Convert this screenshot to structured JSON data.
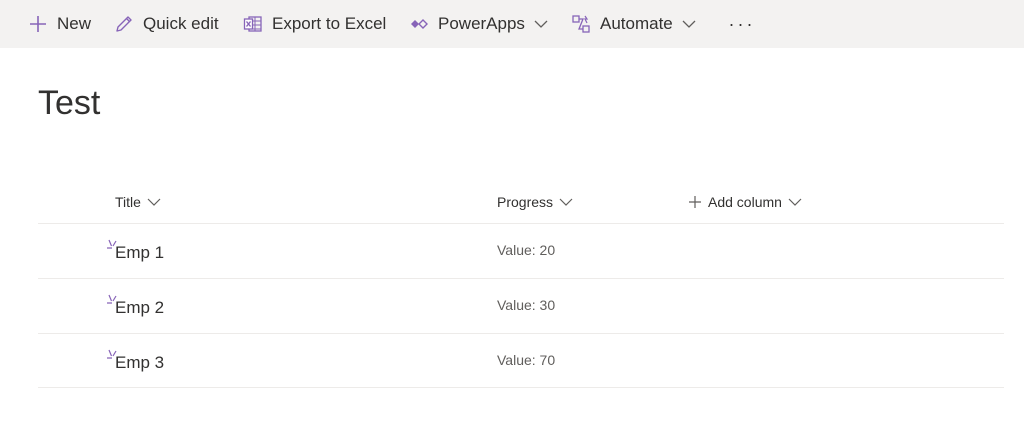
{
  "command_bar": {
    "new_label": "New",
    "quick_edit_label": "Quick edit",
    "export_label": "Export to Excel",
    "powerapps_label": "PowerApps",
    "automate_label": "Automate",
    "more_label": "···"
  },
  "list": {
    "title": "Test",
    "columns": {
      "title": "Title",
      "progress": "Progress",
      "add_column": "Add column"
    },
    "rows": [
      {
        "title": "Emp 1",
        "progress": "Value: 20"
      },
      {
        "title": "Emp 2",
        "progress": "Value: 30"
      },
      {
        "title": "Emp 3",
        "progress": "Value: 70"
      }
    ]
  },
  "colors": {
    "accent": "#8764b8",
    "command_bar_bg": "#f3f2f1",
    "text": "#323130",
    "secondary_text": "#605e5c",
    "divider": "#edebe9"
  },
  "icons": {
    "new": "plus-icon",
    "quick_edit": "pencil-icon",
    "export": "excel-icon",
    "powerapps": "powerapps-icon",
    "automate": "flow-icon",
    "dropdown": "chevron-down-icon",
    "new_item": "new-item-icon"
  }
}
